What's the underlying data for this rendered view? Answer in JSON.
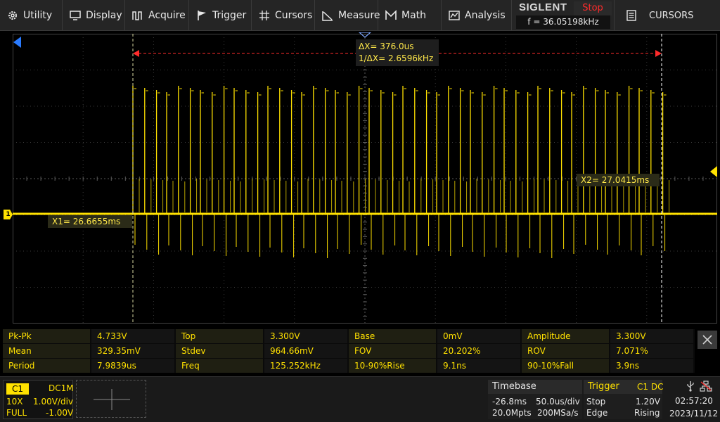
{
  "menu": {
    "items": [
      {
        "label": "Utility",
        "icon": "gear-icon"
      },
      {
        "label": "Display",
        "icon": "display-icon"
      },
      {
        "label": "Acquire",
        "icon": "acquire-icon"
      },
      {
        "label": "Trigger",
        "icon": "flag-icon"
      },
      {
        "label": "Cursors",
        "icon": "crosshair-icon"
      },
      {
        "label": "Measure",
        "icon": "measure-icon"
      },
      {
        "label": "Math",
        "icon": "math-icon"
      },
      {
        "label": "Analysis",
        "icon": "analysis-icon"
      }
    ]
  },
  "brand": {
    "name": "SIGLENT",
    "state": "Stop",
    "freq": "f = 36.05198kHz"
  },
  "cursors_mode": "CURSORS",
  "cursors": {
    "delta_x": "ΔX= 376.0us",
    "inv_delta_x": "1/ΔX= 2.6596kHz",
    "x1": "X1= 26.6655ms",
    "x2": "X2= 27.0415ms"
  },
  "channel_marker": "1",
  "measurements": [
    [
      {
        "name": "Pk-Pk",
        "value": "4.733V"
      },
      {
        "name": "Top",
        "value": "3.300V"
      },
      {
        "name": "Base",
        "value": "0mV"
      },
      {
        "name": "Amplitude",
        "value": "3.300V"
      }
    ],
    [
      {
        "name": "Mean",
        "value": "329.35mV"
      },
      {
        "name": "Stdev",
        "value": "964.66mV"
      },
      {
        "name": "FOV",
        "value": "20.202%"
      },
      {
        "name": "ROV",
        "value": "7.071%"
      }
    ],
    [
      {
        "name": "Period",
        "value": "7.9839us"
      },
      {
        "name": "Freq",
        "value": "125.252kHz"
      },
      {
        "name": "10-90%Rise",
        "value": "9.1ns"
      },
      {
        "name": "90-10%Fall",
        "value": "3.9ns"
      }
    ]
  ],
  "channel1": {
    "tag": "C1",
    "coupling": "DC1M",
    "probe": "10X",
    "scale": "1.00V/div",
    "bandwidth": "FULL",
    "offset": "-1.00V"
  },
  "timebase": {
    "title": "Timebase",
    "delay": "-26.8ms",
    "scale": "50.0us/div",
    "memory": "20.0Mpts",
    "sample_rate": "200MSa/s"
  },
  "trigger": {
    "title": "Trigger",
    "source": "C1 DC",
    "state": "Stop",
    "level": "1.20V",
    "type": "Edge",
    "slope": "Rising"
  },
  "clock": {
    "time": "02:57:20",
    "date": "2023/11/12"
  },
  "colors": {
    "ch1": "#ffe100",
    "cursor_marker": "#ff2b2b",
    "trigger_pos": "#2a7bff",
    "stop": "#ff2b2b"
  }
}
